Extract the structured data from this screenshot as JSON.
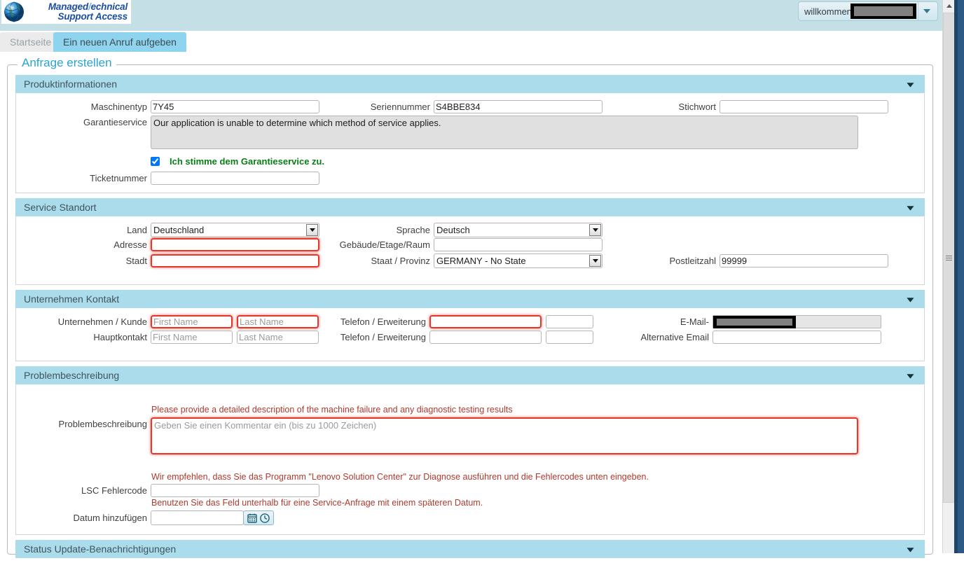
{
  "header": {
    "logo_line1_a": "Managed",
    "logo_line1_slash": "/",
    "logo_line1_b": "echnical",
    "logo_line2": "Support Access",
    "logo_icon": "globe-icon",
    "welcome_text": "willkommen",
    "welcome_user_redacted": "",
    "caret_icon": "chevron-down-icon",
    "bg_color": "#c5dfe6"
  },
  "tabs": [
    {
      "label": "Startseite",
      "active": false
    },
    {
      "label": "Ein neuen Anruf aufgeben",
      "active": true
    }
  ],
  "page": {
    "legend": "Anfrage erstellen",
    "legend_color": "#2aa3d6",
    "accent_panel_color": "#aadcec",
    "required_color": "#e8352a",
    "hint_color": "#b03a2e",
    "agree_color": "#0a7d17"
  },
  "panels": {
    "product": {
      "title": "Produktinformationen",
      "collapse_icon": "chevron-down-icon",
      "machine_type_label": "Maschinentyp",
      "machine_type_value": "7Y45",
      "serial_label": "Seriennummer",
      "serial_value": "S4BBE834",
      "keyword_label": "Stichwort",
      "keyword_value": "",
      "warranty_label": "Garantieservice",
      "warranty_value": "Our application is unable to determine which method of service applies.",
      "agree_checkbox_label": "Ich stimme dem Garantieservice zu.",
      "agree_checked": true,
      "ticket_label": "Ticketnummer",
      "ticket_value": ""
    },
    "location": {
      "title": "Service Standort",
      "collapse_icon": "chevron-down-icon",
      "country_label": "Land",
      "country_value": "Deutschland",
      "address_label": "Adresse",
      "address_value": "",
      "city_label": "Stadt",
      "city_value": "",
      "language_label": "Sprache",
      "language_value": "Deutsch",
      "building_label": "Gebäude/Etage/Raum",
      "building_value": "",
      "state_label": "Staat / Provinz",
      "state_value": "GERMANY - No State",
      "zip_label": "Postleitzahl",
      "zip_value": "99999"
    },
    "contact": {
      "title": "Unternehmen Kontakt",
      "collapse_icon": "chevron-down-icon",
      "company_label": "Unternehmen / Kunde",
      "company_first_placeholder": "First Name",
      "company_last_placeholder": "Last Name",
      "company_first_value": "",
      "company_last_value": "",
      "maincontact_label": "Hauptkontakt",
      "maincontact_first_placeholder": "First Name",
      "maincontact_last_placeholder": "Last Name",
      "phone_label_1": "Telefon / Erweiterung",
      "phone_label_2": "Telefon / Erweiterung",
      "phone1_value": "",
      "ext1_value": "",
      "phone2_value": "",
      "ext2_value": "",
      "email_label": "E-Mail-",
      "email_redacted": "",
      "alt_email_label": "Alternative Email",
      "alt_email_value": ""
    },
    "problem": {
      "title": "Problembeschreibung",
      "collapse_icon": "chevron-down-icon",
      "hint_top": "Please provide a detailed description of the machine failure and any diagnostic testing results",
      "desc_label": "Problembeschreibung",
      "desc_placeholder": "Geben Sie einen Kommentar ein (bis zu 1000 Zeichen)",
      "desc_value": "",
      "hint_lsc": "Wir empfehlen, dass Sie das Programm \"Lenovo Solution Center\" zur Diagnose ausführen und die Fehlercodes unten eingeben.",
      "lsc_label": "LSC Fehlercode",
      "lsc_value": "",
      "hint_date": "Benutzen Sie das Feld unterhalb für eine Service-Anfrage mit einem späteren Datum.",
      "date_label": "Datum hinzufügen",
      "date_value": "",
      "calendar_icon": "calendar-icon",
      "clock_icon": "clock-icon"
    },
    "status": {
      "title": "Status Update-Benachrichtigungen",
      "collapse_icon": "chevron-down-icon"
    }
  },
  "scrollbar": {
    "up_icon": "scroll-up-arrow-icon",
    "grip_icon": "scrollbar-grip-icon"
  }
}
